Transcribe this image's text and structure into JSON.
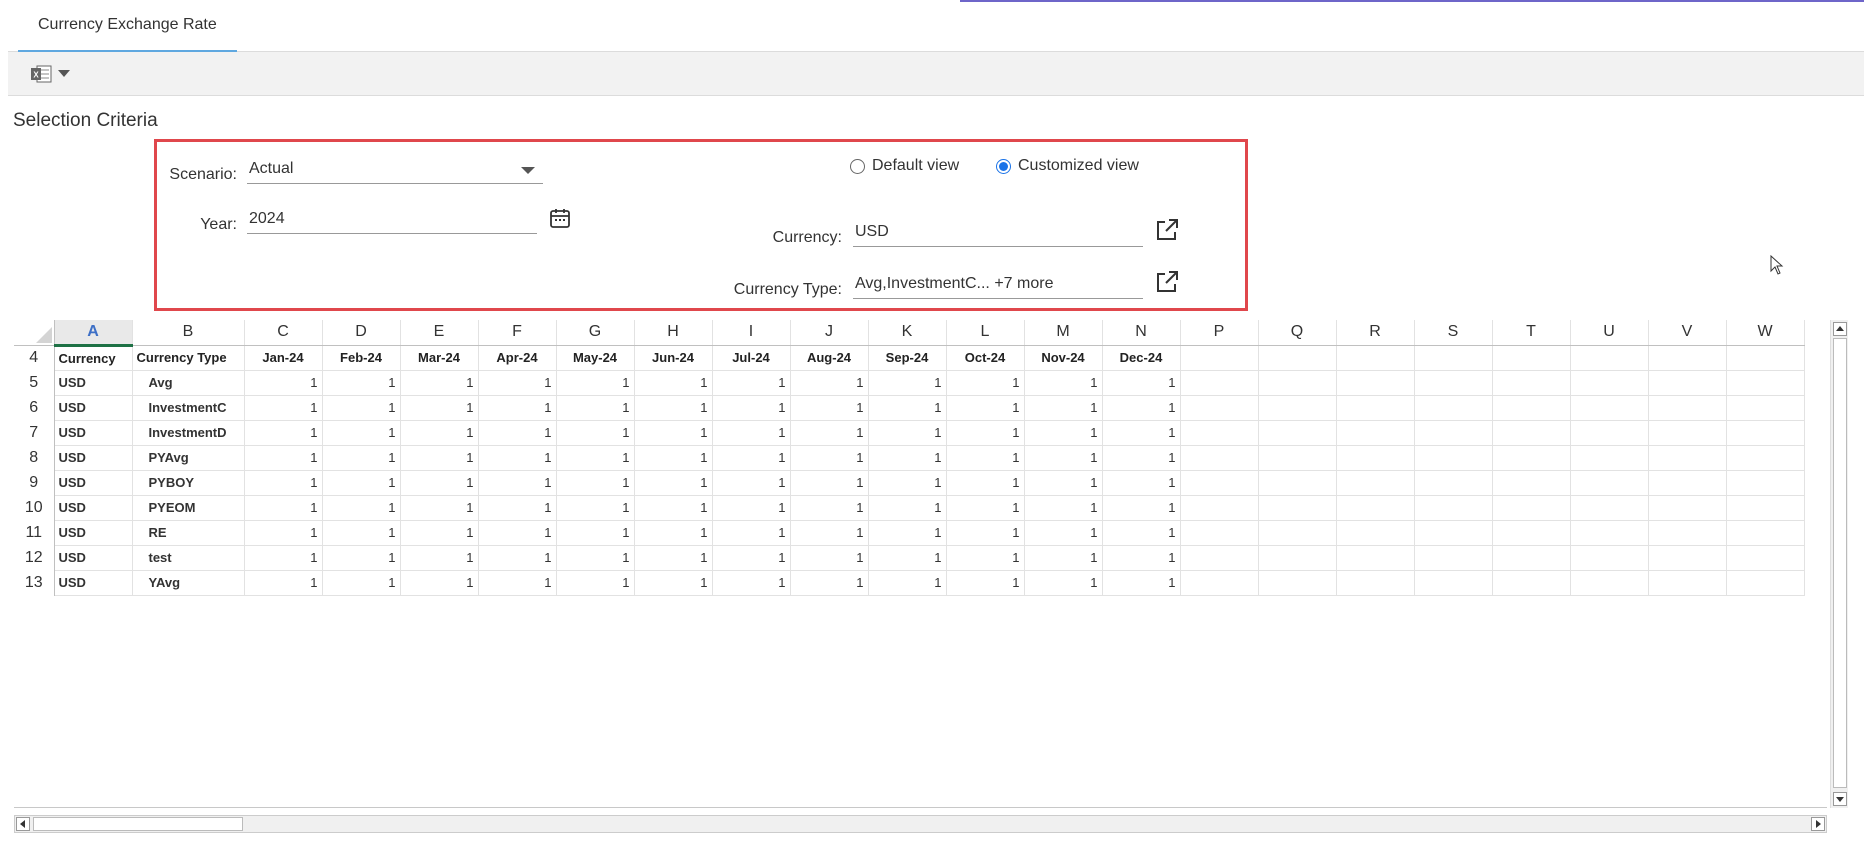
{
  "tab": {
    "label": "Currency Exchange Rate"
  },
  "toolbar": {
    "excel_icon": "excel-icon"
  },
  "selection": {
    "title": "Selection Criteria",
    "scenario_label": "Scenario:",
    "scenario_value": "Actual",
    "year_label": "Year:",
    "year_value": "2024",
    "view_options": {
      "default_label": "Default view",
      "customized_label": "Customized view",
      "selected": "customized"
    },
    "currency_label": "Currency:",
    "currency_value": "USD",
    "currency_type_label": "Currency Type:",
    "currency_type_value": "Avg,InvestmentC... +7 more"
  },
  "sheet": {
    "columns": [
      "A",
      "B",
      "C",
      "D",
      "E",
      "F",
      "G",
      "H",
      "I",
      "J",
      "K",
      "L",
      "M",
      "N",
      "P",
      "Q",
      "R",
      "S",
      "T",
      "U",
      "V",
      "W"
    ],
    "header_row": {
      "row_num": "4",
      "cells": [
        "Currency",
        "Currency Type",
        "Jan-24",
        "Feb-24",
        "Mar-24",
        "Apr-24",
        "May-24",
        "Jun-24",
        "Jul-24",
        "Aug-24",
        "Sep-24",
        "Oct-24",
        "Nov-24",
        "Dec-24"
      ]
    },
    "rows": [
      {
        "row_num": "5",
        "currency": "USD",
        "type": "Avg",
        "values": [
          "1",
          "1",
          "1",
          "1",
          "1",
          "1",
          "1",
          "1",
          "1",
          "1",
          "1",
          "1"
        ]
      },
      {
        "row_num": "6",
        "currency": "USD",
        "type": "InvestmentC",
        "values": [
          "1",
          "1",
          "1",
          "1",
          "1",
          "1",
          "1",
          "1",
          "1",
          "1",
          "1",
          "1"
        ]
      },
      {
        "row_num": "7",
        "currency": "USD",
        "type": "InvestmentD",
        "values": [
          "1",
          "1",
          "1",
          "1",
          "1",
          "1",
          "1",
          "1",
          "1",
          "1",
          "1",
          "1"
        ]
      },
      {
        "row_num": "8",
        "currency": "USD",
        "type": "PYAvg",
        "values": [
          "1",
          "1",
          "1",
          "1",
          "1",
          "1",
          "1",
          "1",
          "1",
          "1",
          "1",
          "1"
        ]
      },
      {
        "row_num": "9",
        "currency": "USD",
        "type": "PYBOY",
        "values": [
          "1",
          "1",
          "1",
          "1",
          "1",
          "1",
          "1",
          "1",
          "1",
          "1",
          "1",
          "1"
        ]
      },
      {
        "row_num": "10",
        "currency": "USD",
        "type": "PYEOM",
        "values": [
          "1",
          "1",
          "1",
          "1",
          "1",
          "1",
          "1",
          "1",
          "1",
          "1",
          "1",
          "1"
        ]
      },
      {
        "row_num": "11",
        "currency": "USD",
        "type": "RE",
        "values": [
          "1",
          "1",
          "1",
          "1",
          "1",
          "1",
          "1",
          "1",
          "1",
          "1",
          "1",
          "1"
        ]
      },
      {
        "row_num": "12",
        "currency": "USD",
        "type": "test",
        "values": [
          "1",
          "1",
          "1",
          "1",
          "1",
          "1",
          "1",
          "1",
          "1",
          "1",
          "1",
          "1"
        ]
      },
      {
        "row_num": "13",
        "currency": "USD",
        "type": "YAvg",
        "values": [
          "1",
          "1",
          "1",
          "1",
          "1",
          "1",
          "1",
          "1",
          "1",
          "1",
          "1",
          "1"
        ]
      }
    ]
  },
  "colors": {
    "highlight_border": "#e0474c",
    "tab_underline": "#5fa8e0",
    "radio_selected": "#1a73e8",
    "active_col_underline": "#1e7145"
  }
}
